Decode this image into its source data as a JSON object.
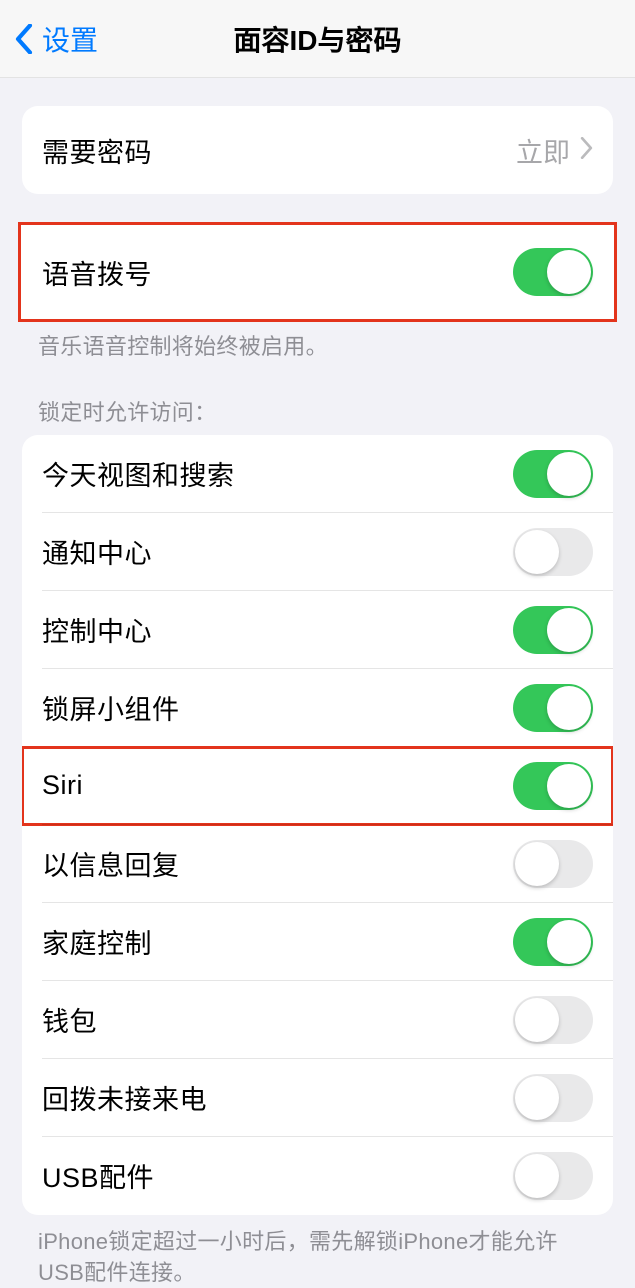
{
  "nav": {
    "back": "设置",
    "title": "面容ID与密码"
  },
  "passcode": {
    "label": "需要密码",
    "value": "立即"
  },
  "voiceDial": {
    "label": "语音拨号",
    "on": true,
    "footer": "音乐语音控制将始终被启用。"
  },
  "lockAccess": {
    "header": "锁定时允许访问：",
    "items": [
      {
        "label": "今天视图和搜索",
        "on": true,
        "highlight": false
      },
      {
        "label": "通知中心",
        "on": false,
        "highlight": false
      },
      {
        "label": "控制中心",
        "on": true,
        "highlight": false
      },
      {
        "label": "锁屏小组件",
        "on": true,
        "highlight": false
      },
      {
        "label": "Siri",
        "on": true,
        "highlight": true
      },
      {
        "label": "以信息回复",
        "on": false,
        "highlight": false
      },
      {
        "label": "家庭控制",
        "on": true,
        "highlight": false
      },
      {
        "label": "钱包",
        "on": false,
        "highlight": false
      },
      {
        "label": "回拨未接来电",
        "on": false,
        "highlight": false
      },
      {
        "label": "USB配件",
        "on": false,
        "highlight": false
      }
    ],
    "footer": "iPhone锁定超过一小时后，需先解锁iPhone才能允许USB配件连接。"
  }
}
